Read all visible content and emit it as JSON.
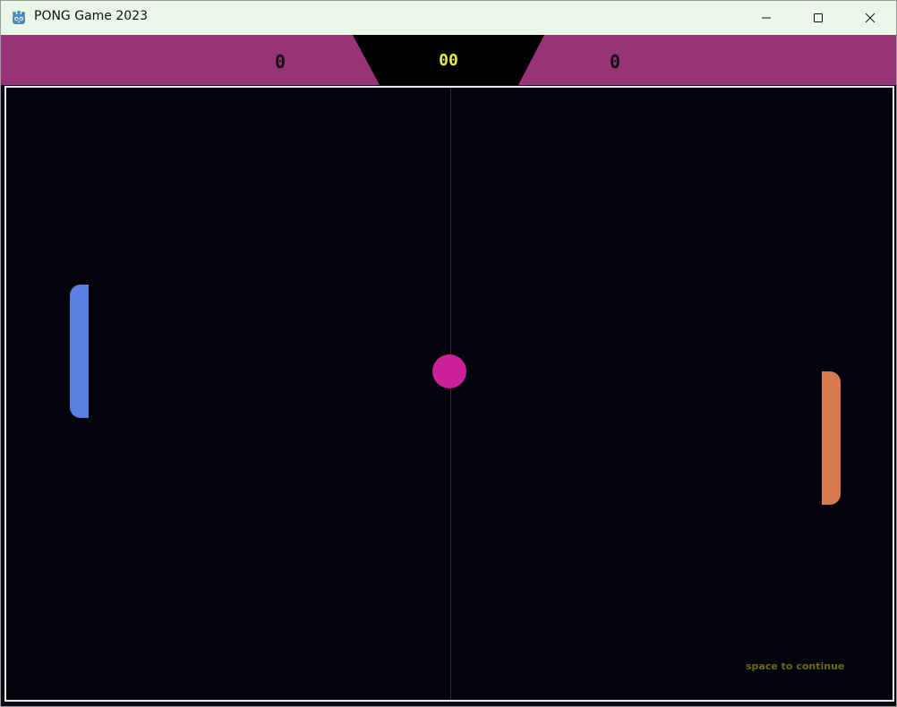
{
  "window": {
    "title": "PONG Game 2023",
    "icon": "godot-engine-icon",
    "controls": {
      "minimize_icon": "minimize-icon",
      "maximize_icon": "maximize-icon",
      "close_icon": "close-icon"
    }
  },
  "hud": {
    "score_left": "0",
    "score_right": "0",
    "timer": "00",
    "colors": {
      "bar": "#993377",
      "center": "#000000",
      "timer": "#e6e64a"
    }
  },
  "game": {
    "hint": "space to continue",
    "colors": {
      "background": "#03030c",
      "border": "#e8e8e8",
      "paddle_left": "#5b7fe0",
      "paddle_right": "#d87a50",
      "ball": "#cc2299",
      "hint": "#6b6a1a"
    }
  }
}
